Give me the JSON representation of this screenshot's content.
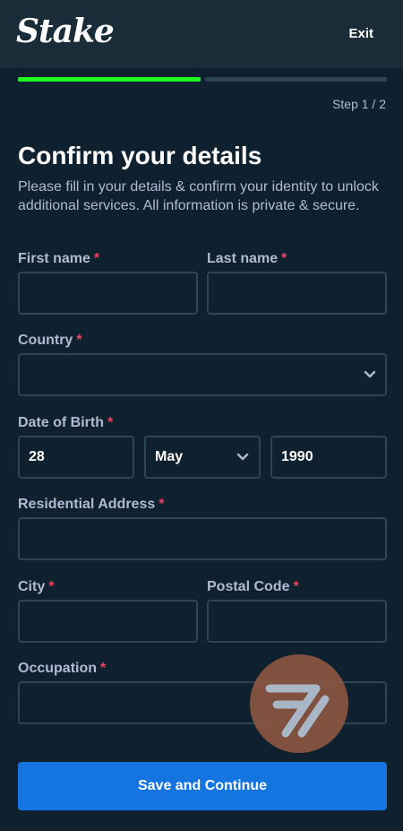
{
  "header": {
    "logo": "Stake",
    "exit_label": "Exit"
  },
  "progress": {
    "current_step": 1,
    "total_steps": 2,
    "label": "Step 1 / 2",
    "colors": {
      "done": "#1fff20",
      "todo": "#2f4553"
    }
  },
  "page": {
    "title": "Confirm your details",
    "description": "Please fill in your details & confirm your identity to unlock additional services. All information is private & secure."
  },
  "form": {
    "required_marker": "*",
    "first_name": {
      "label": "First name",
      "value": ""
    },
    "last_name": {
      "label": "Last name",
      "value": ""
    },
    "country": {
      "label": "Country",
      "value": ""
    },
    "dob": {
      "label": "Date of Birth",
      "day": "28",
      "month": "May",
      "year": "1990"
    },
    "address": {
      "label": "Residential Address",
      "value": ""
    },
    "city": {
      "label": "City",
      "value": ""
    },
    "postal_code": {
      "label": "Postal Code",
      "value": ""
    },
    "occupation": {
      "label": "Occupation",
      "value": ""
    }
  },
  "submit_label": "Save and Continue",
  "colors": {
    "background": "#0f212e",
    "header": "#1a2c38",
    "accent": "#1475e1",
    "required": "#ed4163",
    "muted_text": "#b1bad3"
  }
}
